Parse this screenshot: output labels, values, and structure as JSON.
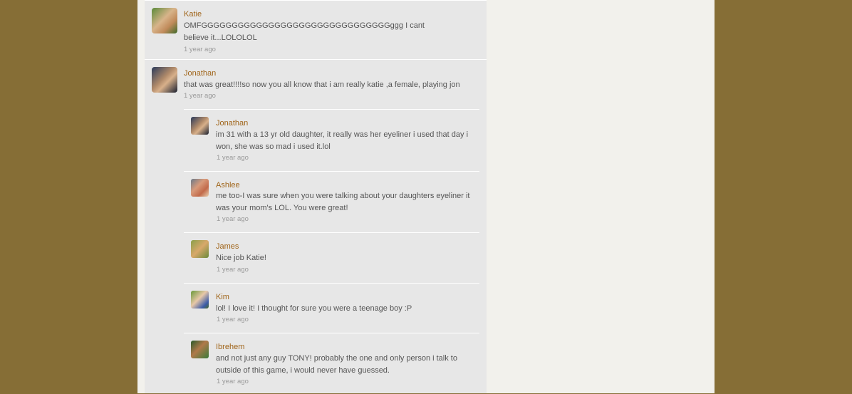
{
  "comments": [
    {
      "name": "Katie",
      "text": "OMFGGGGGGGGGGGGGGGGGGGGGGGGGGGGGGGggg  I cant believe it...LOLOLOL",
      "time": "1 year ago",
      "avatar": "katie-avatar"
    },
    {
      "name": "Jonathan",
      "text": "that was great!!!!so now you all know that i am really katie ,a female, playing jon",
      "time": "1 year ago",
      "avatar": "jonathan-avatar",
      "replies": [
        {
          "name": "Jonathan",
          "text": "im 31 with a 13 yr old daughter, it really was her eyeliner i used that day i won, she was so mad i used it.lol",
          "time": "1 year ago",
          "avatar": "jonathan-avatar"
        },
        {
          "name": "Ashlee",
          "text": "me too-I was sure when you were talking about your daughters eyeliner it was your mom's LOL.  You were great!",
          "time": "1 year ago",
          "avatar": "ashlee-avatar"
        },
        {
          "name": "James",
          "text": "Nice job Katie!",
          "time": "1 year ago",
          "avatar": "james-avatar"
        },
        {
          "name": "Kim",
          "text": "lol! I love it! I thought for sure you were a teenage boy :P",
          "time": "1 year ago",
          "avatar": "kim-avatar"
        },
        {
          "name": "Ibrehem",
          "text": "and not just any guy TONY! probably the one and only person i talk to outside of this game, i would never have guessed.",
          "time": "1 year ago",
          "avatar": "ibrehem-avatar"
        }
      ]
    }
  ]
}
